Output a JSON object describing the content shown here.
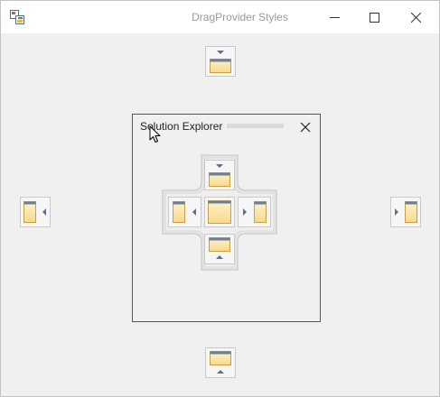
{
  "window": {
    "title": "DragProvider Styles",
    "controls": [
      "minimize-icon",
      "maximize-icon",
      "close-icon"
    ]
  },
  "panel": {
    "title": "Solution Explorer",
    "close": "close-icon"
  },
  "dock_guides": {
    "outer": [
      "dock-top",
      "dock-left",
      "dock-right",
      "dock-bottom"
    ],
    "inner": [
      "dock-inner-top",
      "dock-inner-left",
      "dock-inner-center",
      "dock-inner-right",
      "dock-inner-bottom"
    ]
  },
  "colors": {
    "guide_fill": "#fce6a4",
    "guide_border": "#c8a04a",
    "guide_header": "#6d7f92",
    "arrow": "#5b7087"
  }
}
